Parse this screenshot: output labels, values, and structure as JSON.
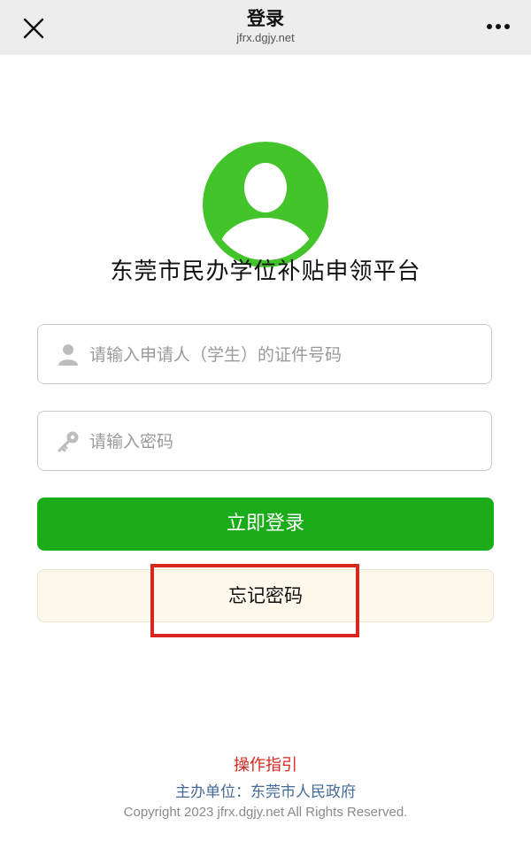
{
  "header": {
    "title": "登录",
    "url": "jfrx.dgjy.net"
  },
  "platform_title": "东莞市民办学位补贴申领平台",
  "form": {
    "id_placeholder": "请输入申请人（学生）的证件号码",
    "id_value": "",
    "password_placeholder": "请输入密码",
    "password_value": ""
  },
  "buttons": {
    "login": "立即登录",
    "forgot_password": "忘记密码"
  },
  "footer": {
    "guide": "操作指引",
    "sponsor": "主办单位：东莞市人民政府",
    "copyright": "Copyright 2023 jfrx.dgjy.net All Rights Reserved."
  },
  "colors": {
    "accent_green": "#1aad19",
    "avatar_green": "#43c42a",
    "highlight_red": "#d9271f",
    "link_red": "#d9271f",
    "sponsor_blue": "#456a99"
  },
  "icons": {
    "close": "close-icon",
    "more": "more-icon",
    "user_field": "user-icon",
    "password_field": "key-icon"
  }
}
